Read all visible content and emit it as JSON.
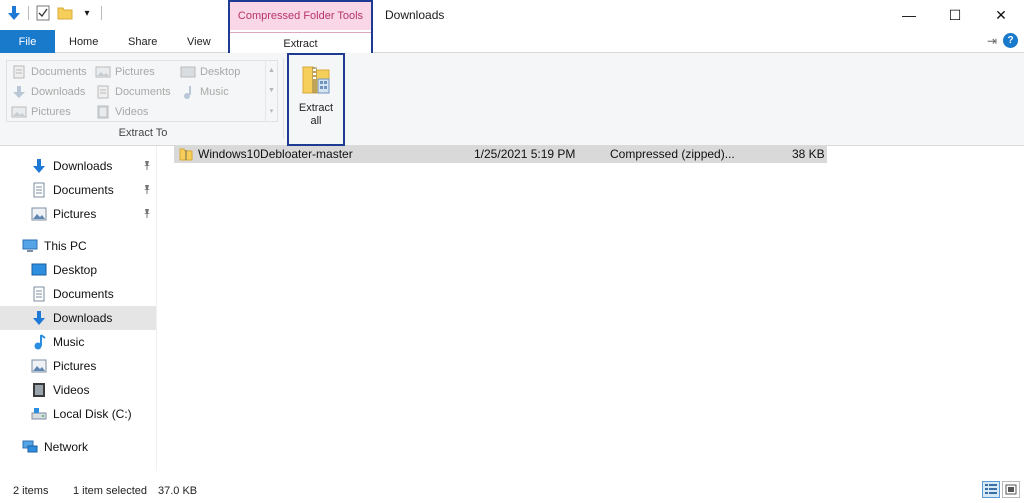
{
  "window": {
    "title": "Downloads",
    "controls": {
      "minimize": "—",
      "maximize": "☐",
      "close": "✕"
    }
  },
  "quick_access_toolbar": {
    "icons": [
      "down-arrow-icon",
      "properties-icon",
      "new-folder-icon",
      "customize-dropdown-icon"
    ],
    "customize_glyph": "▾"
  },
  "contextual_group": {
    "header": "Compressed Folder Tools",
    "tab": "Extract",
    "header_color": "#f9d7e6",
    "header_text_color": "#b6346b"
  },
  "ribbon_tabs": {
    "file": "File",
    "home": "Home",
    "share": "Share",
    "view": "View"
  },
  "ribbon_right": {
    "pin_glyph": "⇥",
    "help_glyph": "?"
  },
  "extract_to": {
    "group_label": "Extract To",
    "items": [
      {
        "label": "Documents",
        "icon": "documents-icon"
      },
      {
        "label": "Pictures",
        "icon": "pictures-icon"
      },
      {
        "label": "Desktop",
        "icon": "desktop-icon"
      },
      {
        "label": "Downloads",
        "icon": "downloads-icon"
      },
      {
        "label": "Documents",
        "icon": "documents-icon"
      },
      {
        "label": "Music",
        "icon": "music-icon"
      },
      {
        "label": "Pictures",
        "icon": "pictures-icon"
      },
      {
        "label": "Videos",
        "icon": "videos-icon"
      }
    ],
    "scroll_glyphs": [
      "▲",
      "▼",
      "▾"
    ],
    "extract_all_label": "Extract all"
  },
  "navigation": {
    "quick_access": [
      {
        "label": "Downloads",
        "icon": "downloads-icon",
        "pinned": true
      },
      {
        "label": "Documents",
        "icon": "documents-icon",
        "pinned": true
      },
      {
        "label": "Pictures",
        "icon": "pictures-icon",
        "pinned": true
      }
    ],
    "this_pc_label": "This PC",
    "this_pc_items": [
      {
        "label": "Desktop",
        "icon": "desktop-icon"
      },
      {
        "label": "Documents",
        "icon": "documents-icon"
      },
      {
        "label": "Downloads",
        "icon": "downloads-icon",
        "selected": true
      },
      {
        "label": "Music",
        "icon": "music-icon"
      },
      {
        "label": "Pictures",
        "icon": "pictures-icon"
      },
      {
        "label": "Videos",
        "icon": "videos-icon"
      },
      {
        "label": "Local Disk (C:)",
        "icon": "local-disk-icon"
      }
    ],
    "network_label": "Network"
  },
  "files": [
    {
      "name": "Windows10Debloater-master",
      "date": "1/25/2021 5:19 PM",
      "type": "Compressed (zipped)...",
      "size": "38 KB",
      "selected": true
    }
  ],
  "status_bar": {
    "item_count": "2 items",
    "selection": "1 item selected",
    "size": "37.0 KB"
  },
  "colors": {
    "accent": "#1979ca",
    "highlight_border": "#1f3a93",
    "selection_bg": "#d9d9d9"
  }
}
